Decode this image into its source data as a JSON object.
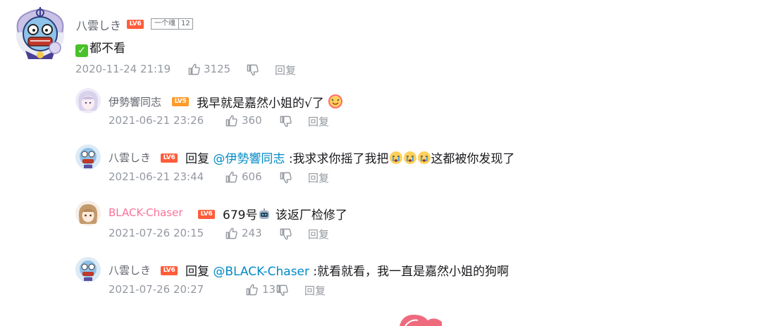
{
  "comments": [
    {
      "user": "八雲しき",
      "level": "LV6",
      "fan_badge": {
        "name": "一个魂",
        "level": "12"
      },
      "content": "都不看",
      "time": "2020-11-24 21:19",
      "likes": "3125",
      "reply_label": "回复"
    }
  ],
  "replies": [
    {
      "user": "伊勢響同志",
      "level": "LV5",
      "content": "我早就是嘉然小姐的√了",
      "time": "2021-06-21 23:26",
      "likes": "360",
      "reply_label": "回复"
    },
    {
      "user": "八雲しき",
      "level": "LV6",
      "reply_prefix": "回复",
      "at_user": "@伊勢響同志",
      "content": ":我求求你摇了我把",
      "content_suffix": "这都被你发现了",
      "time": "2021-06-21 23:44",
      "likes": "606",
      "reply_label": "回复"
    },
    {
      "user": "BLACK-Chaser",
      "level": "LV6",
      "content": "679号",
      "content_suffix": " 该返厂检修了",
      "time": "2021-07-26 20:15",
      "likes": "243",
      "reply_label": "回复"
    },
    {
      "user": "八雲しき",
      "level": "LV6",
      "reply_prefix": "回复",
      "at_user": "@BLACK-Chaser",
      "content": ":就看就看，我一直是嘉然小姐的狗啊",
      "time": "2021-07-26 20:27",
      "likes": "131",
      "reply_label": "回复"
    }
  ],
  "icons": {
    "like": "thumbs-up-icon",
    "dislike": "thumbs-down-icon",
    "check": "check-mark-icon",
    "emoji_heart": "heart-face-emoji",
    "emoji_cry": "crying-face-emoji",
    "emoji_robot": "robot-face-emoji"
  },
  "colors": {
    "username": "#61666d",
    "username_highlight": "#fb7299",
    "at_link": "#008ac5",
    "meta": "#9499a0",
    "level_badge": "#ff5c3a"
  }
}
